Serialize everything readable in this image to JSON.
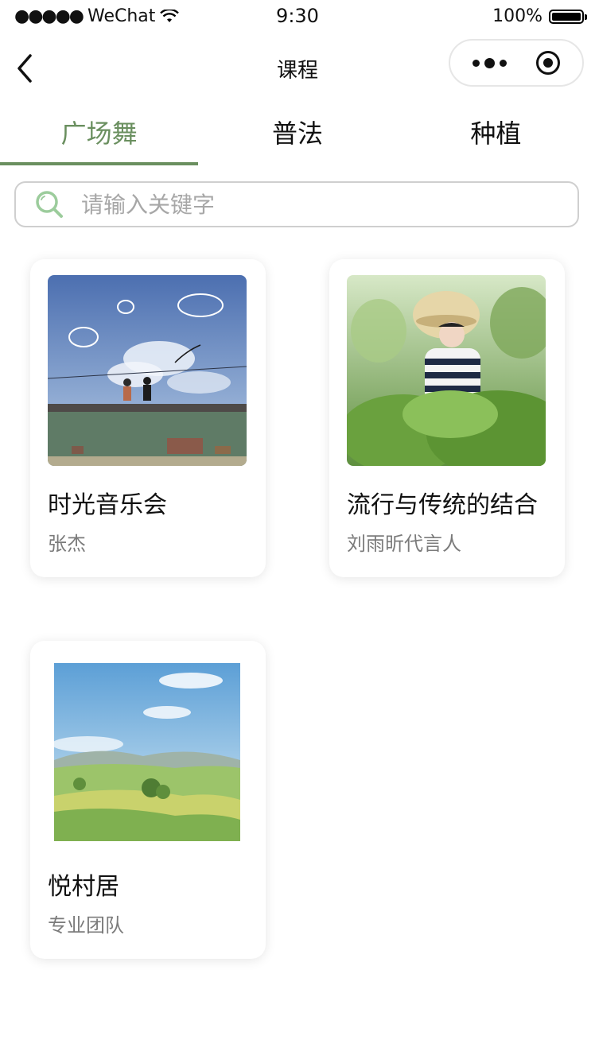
{
  "status": {
    "carrier": "WeChat",
    "time": "9:30",
    "battery": "100%"
  },
  "nav": {
    "title": "课程"
  },
  "tabs": [
    {
      "label": "广场舞",
      "active": true
    },
    {
      "label": "普法",
      "active": false
    },
    {
      "label": "种植",
      "active": false
    }
  ],
  "search": {
    "placeholder": "请输入关键字",
    "value": ""
  },
  "courses": [
    {
      "title": "时光音乐会",
      "author": "张杰",
      "image": "anime-sky-illustration"
    },
    {
      "title": "流行与传统的结合",
      "author": "刘雨昕代言人",
      "image": "person-in-green-field-photo"
    },
    {
      "title": "悦村居",
      "author": "专业团队",
      "image": "watercolor-landscape"
    }
  ],
  "colors": {
    "accent": "#6a8f5f",
    "text": "#111111",
    "subtext": "#7b7b7b",
    "border": "#cfcfcf"
  }
}
